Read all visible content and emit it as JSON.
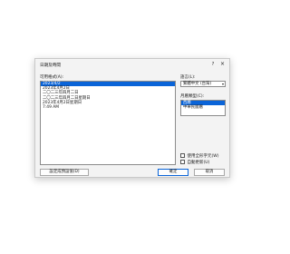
{
  "dialog": {
    "title": "日期及時間",
    "help_label": "?",
    "close_label": "×"
  },
  "formats": {
    "label": "可用格式(A):",
    "items": [
      {
        "text": "2023/4/2",
        "selected": true
      },
      {
        "text": "2023年4月2日",
        "selected": false
      },
      {
        "text": "二〇二三年四月二日",
        "selected": false
      },
      {
        "text": "二〇二三年四月二日星期日",
        "selected": false
      },
      {
        "text": "2023年4月2日星期日",
        "selected": false
      },
      {
        "text": "7:49 AM",
        "selected": false
      }
    ]
  },
  "language": {
    "label": "語言(L):",
    "value": "繁體中文 (台灣)"
  },
  "calendar": {
    "label": "月曆類型(C):",
    "items": [
      {
        "text": "西曆",
        "selected": true
      },
      {
        "text": "中華民國曆",
        "selected": false
      }
    ]
  },
  "options": {
    "use_fullwidth": "使用全形字元(W)",
    "auto_update": "自動更新(U)"
  },
  "buttons": {
    "set_default": "設定成預設值(D)",
    "ok": "確定",
    "cancel": "取消"
  },
  "colors": {
    "accent": "#0a64d8",
    "dialog_bg": "#f3f3f3"
  }
}
